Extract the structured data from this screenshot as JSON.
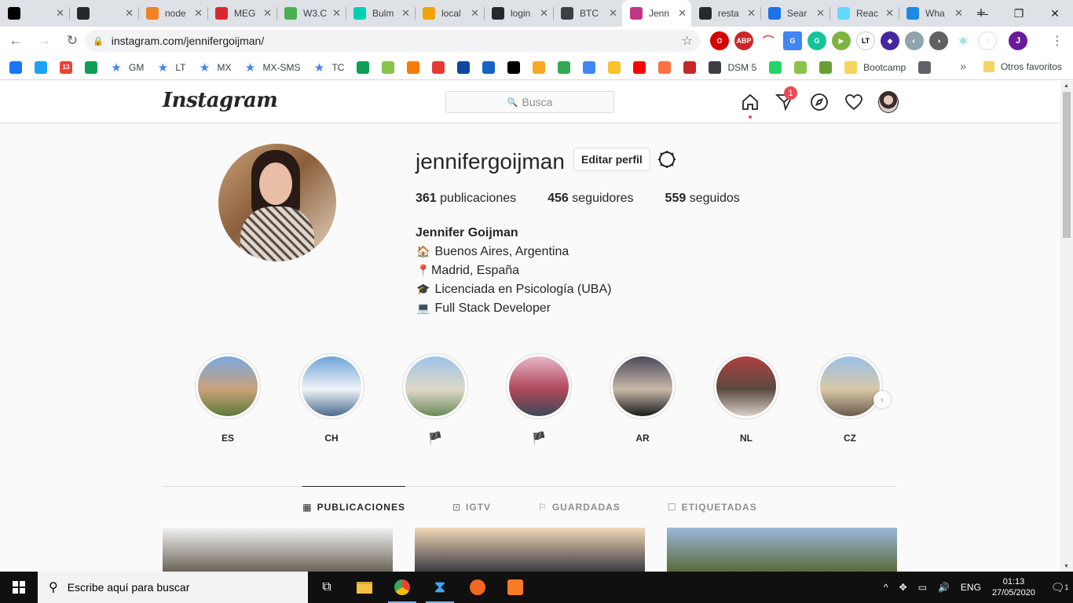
{
  "browser": {
    "tabs": [
      {
        "title": "",
        "icon_color": "#000000",
        "icon": "youtube-icon"
      },
      {
        "title": "",
        "icon_color": "#24292e",
        "icon": "github-icon"
      },
      {
        "title": "node",
        "icon_color": "#f48024",
        "icon": "stackoverflow-icon"
      },
      {
        "title": "MEG",
        "icon_color": "#d9272e",
        "icon": "mega-icon"
      },
      {
        "title": "W3.C",
        "icon_color": "#4caf50",
        "icon": "w3schools-icon"
      },
      {
        "title": "Bulm",
        "icon_color": "#00d1b2",
        "icon": "bulma-icon"
      },
      {
        "title": "local",
        "icon_color": "#f0a30a",
        "icon": "phpmyadmin-icon"
      },
      {
        "title": "login",
        "icon_color": "#24292e",
        "icon": "github-icon"
      },
      {
        "title": "BTC",
        "icon_color": "#3c4043",
        "icon": "contact-card-icon"
      },
      {
        "title": "Jenn",
        "icon_color": "#c13584",
        "icon": "instagram-icon",
        "active": true
      },
      {
        "title": "resta",
        "icon_color": "#24292e",
        "icon": "github-icon"
      },
      {
        "title": "Sear",
        "icon_color": "#1a73e8",
        "icon": "search-console-icon"
      },
      {
        "title": "Reac",
        "icon_color": "#61dafb",
        "icon": "react-icon"
      },
      {
        "title": "Wha",
        "icon_color": "#1e88e5",
        "icon": "whatsapp-web-icon"
      }
    ],
    "url": "instagram.com/jennifergoijman/",
    "bookmarks": [
      {
        "label": "",
        "icon_color": "#1877f2",
        "icon": "facebook-icon"
      },
      {
        "label": "",
        "icon_color": "#1da1f2",
        "icon": "twitter-icon"
      },
      {
        "label": "",
        "icon_color": "#ea4335",
        "icon": "gmail-icon",
        "badge": "13"
      },
      {
        "label": "",
        "icon_color": "#0f9d58",
        "icon": "drive-icon"
      },
      {
        "label": "GM",
        "icon": "star-icon"
      },
      {
        "label": "LT",
        "icon": "star-icon"
      },
      {
        "label": "MX",
        "icon": "star-icon"
      },
      {
        "label": "MX-SMS",
        "icon": "star-icon"
      },
      {
        "label": "TC",
        "icon": "star-icon"
      },
      {
        "label": "",
        "icon_color": "#0f9d58",
        "icon": "hangouts-icon"
      },
      {
        "label": "",
        "icon_color": "#8bc34a",
        "icon": "olx-icon"
      },
      {
        "label": "",
        "icon_color": "#f57c00",
        "icon": "orange-app-icon"
      },
      {
        "label": "",
        "icon_color": "#e53935",
        "icon": "red-app-icon"
      },
      {
        "label": "",
        "icon_color": "#0d47a1",
        "icon": "ln-icon"
      },
      {
        "label": "",
        "icon_color": "#1565c0",
        "icon": "globe-icon"
      },
      {
        "label": "",
        "icon_color": "#000000",
        "icon": "e-icon"
      },
      {
        "label": "",
        "icon_color": "#f9a825",
        "icon": "2048-icon"
      },
      {
        "label": "",
        "icon_color": "#34a853",
        "icon": "maps-icon"
      },
      {
        "label": "",
        "icon_color": "#4285f4",
        "icon": "translate-icon"
      },
      {
        "label": "",
        "icon_color": "#fbc02d",
        "icon": "flag-icon"
      },
      {
        "label": "",
        "icon_color": "#ff0000",
        "icon": "youtube-icon"
      },
      {
        "label": "",
        "icon_color": "#ff7043",
        "icon": "audio-icon"
      },
      {
        "label": "",
        "icon_color": "#c62828",
        "icon": "mic-icon"
      },
      {
        "label": "DSM 5",
        "icon_color": "#3c4043",
        "icon": "github-icon"
      },
      {
        "label": "",
        "icon_color": "#25d366",
        "icon": "whatsapp-icon"
      },
      {
        "label": "",
        "icon_color": "#8bc34a",
        "icon": "green-app-icon"
      },
      {
        "label": "",
        "icon_color": "#689f38",
        "icon": "f-icon"
      },
      {
        "label": "Bootcamp",
        "icon": "folder-icon"
      },
      {
        "label": "",
        "icon_color": "#5f6368",
        "icon": "plane-icon"
      }
    ],
    "bookmarks_more": "»",
    "other_bookmarks": "Otros favoritos",
    "profile_initial": "J"
  },
  "instagram": {
    "logo": "Instagram",
    "search_placeholder": "Busca",
    "notifications_badge": "1",
    "profile": {
      "username": "jennifergoijman",
      "edit_button": "Editar perfil",
      "posts_count": "361",
      "posts_label": "publicaciones",
      "followers_count": "456",
      "followers_label": "seguidores",
      "following_count": "559",
      "following_label": "seguidos",
      "full_name": "Jennifer Goijman",
      "bio_lines": [
        {
          "emoji": "🏠",
          "text": "Buenos Aires, Argentina"
        },
        {
          "emoji": "📍",
          "text": "Madrid, España"
        },
        {
          "emoji": "🎓",
          "text": "Licenciada en Psicología (UBA)"
        },
        {
          "emoji": "💻",
          "text": "Full Stack Developer"
        }
      ]
    },
    "highlights": [
      {
        "label": "ES",
        "colors": [
          "#7aa9e0",
          "#c9a27a",
          "#5b7a3a"
        ]
      },
      {
        "label": "CH",
        "colors": [
          "#6fa3d8",
          "#f0f4f8",
          "#4a6a8a"
        ]
      },
      {
        "label": "",
        "flag": "🏴",
        "colors": [
          "#9cc3e8",
          "#e0d8c8",
          "#6a8a5a"
        ]
      },
      {
        "label": "",
        "flag": "🏴",
        "colors": [
          "#e6b7c8",
          "#b0475a",
          "#3a4a5a"
        ]
      },
      {
        "label": "AR",
        "colors": [
          "#4a4a5a",
          "#c8b8a8",
          "#1a1a1a"
        ]
      },
      {
        "label": "NL",
        "colors": [
          "#b04040",
          "#5a4a40",
          "#d8d0c8"
        ]
      },
      {
        "label": "CZ",
        "colors": [
          "#9ac0e8",
          "#d8c8a8",
          "#6a5a4a"
        ]
      }
    ],
    "tabs": [
      {
        "label": "PUBLICACIONES",
        "icon": "grid-icon",
        "glyph": "▦",
        "active": true
      },
      {
        "label": "IGTV",
        "icon": "igtv-icon",
        "glyph": "⊡"
      },
      {
        "label": "GUARDADAS",
        "icon": "bookmark-icon",
        "glyph": "⚐"
      },
      {
        "label": "ETIQUETADAS",
        "icon": "tagged-icon",
        "glyph": "☐"
      }
    ],
    "posts": [
      {
        "colors": [
          "#f2f2f2",
          "#6b6358"
        ]
      },
      {
        "colors": [
          "#f3d9b8",
          "#3a3a40"
        ]
      },
      {
        "colors": [
          "#9bb8d8",
          "#5a6a3a"
        ]
      }
    ]
  },
  "taskbar": {
    "search_placeholder": "Escribe aquí para buscar",
    "language": "ENG",
    "time": "01:13",
    "date": "27/05/2020",
    "notifications": "1"
  }
}
